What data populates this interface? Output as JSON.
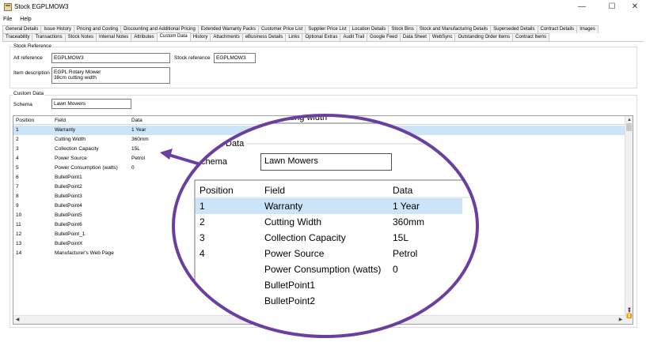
{
  "window": {
    "title": "Stock EGPLMOW3",
    "minimize": "—",
    "maximize": "☐",
    "close": "✕"
  },
  "menu": [
    "File",
    "Help"
  ],
  "tabs_row1": [
    "General Details",
    "Issue History",
    "Pricing and Costing",
    "Discounting and Additional Pricing",
    "Extended Warranty Packs",
    "Customer Price List",
    "Supplier Price List",
    "Location Details",
    "Stock Bins",
    "Stock and Manufacturing Details",
    "Superseded Details",
    "Contract Details",
    "Images"
  ],
  "tabs_row2": [
    "Traceability",
    "Transactions",
    "Stock Notes",
    "Internal Notes",
    "Attributes",
    "Custom Data",
    "History",
    "Attachments",
    "eBusiness Details",
    "Links",
    "Optional Extras",
    "Audit Trail",
    "Google Feed",
    "Data Sheet",
    "WebSync",
    "Outstanding Order Items",
    "Contract Items"
  ],
  "active_tab": "Custom Data",
  "stock_reference_group": {
    "legend": "Stock Reference",
    "alt_reference_label": "Alt reference",
    "alt_reference_value": "EGPLMOW3",
    "stock_reference_label": "Stock reference",
    "stock_reference_value": "EGPLMOW3",
    "item_description_label": "Item description",
    "item_description_value": "EGPL Rotary Mower\n38cm cutting width"
  },
  "custom_data_group": {
    "legend": "Custom Data",
    "schema_label": "Schema",
    "schema_value": "Lawn Mowers"
  },
  "grid": {
    "columns": [
      "Position",
      "Field",
      "Data"
    ],
    "rows": [
      {
        "position": "1",
        "field": "Warranty",
        "data": "1 Year"
      },
      {
        "position": "2",
        "field": "Cutting Width",
        "data": "360mm"
      },
      {
        "position": "3",
        "field": "Collection Capacity",
        "data": "15L"
      },
      {
        "position": "4",
        "field": "Power Source",
        "data": "Petrol"
      },
      {
        "position": "5",
        "field": "Power Consumption (watts)",
        "data": "0"
      },
      {
        "position": "6",
        "field": "BulletPoint1",
        "data": ""
      },
      {
        "position": "7",
        "field": "BulletPoint2",
        "data": ""
      },
      {
        "position": "8",
        "field": "BulletPoint3",
        "data": ""
      },
      {
        "position": "9",
        "field": "BulletPoint4",
        "data": ""
      },
      {
        "position": "10",
        "field": "BulletPoint5",
        "data": ""
      },
      {
        "position": "11",
        "field": "BulletPoint6",
        "data": ""
      },
      {
        "position": "12",
        "field": "BulletPoint_1",
        "data": ""
      },
      {
        "position": "13",
        "field": "BulletPointX",
        "data": ""
      },
      {
        "position": "14",
        "field": "Manufacturer's Web Page",
        "data": ""
      }
    ],
    "selected_row": 0
  },
  "zoom": {
    "frag_top": "cutting width",
    "frag_legend": "Data",
    "schema_label": "chema",
    "schema_value": "Lawn Mowers",
    "columns": [
      "Position",
      "Field",
      "Data"
    ],
    "rows": [
      {
        "position": "1",
        "field": "Warranty",
        "data": "1 Year"
      },
      {
        "position": "2",
        "field": "Cutting Width",
        "data": "360mm"
      },
      {
        "position": "3",
        "field": "Collection Capacity",
        "data": "15L"
      },
      {
        "position": "4",
        "field": "Power Source",
        "data": "Petrol"
      },
      {
        "position": "",
        "field": "Power Consumption (watts)",
        "data": "0"
      },
      {
        "position": "",
        "field": "BulletPoint1",
        "data": ""
      },
      {
        "position": "",
        "field": "BulletPoint2",
        "data": ""
      }
    ]
  },
  "colors": {
    "callout": "#6b3fa0",
    "selection": "#cce4f7"
  }
}
